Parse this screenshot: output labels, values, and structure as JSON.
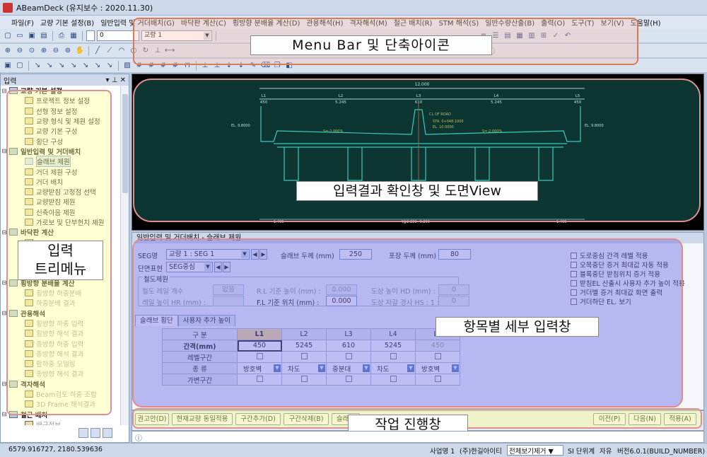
{
  "window": {
    "title": "ABeamDeck  (유지보수 : 2020.11.30)"
  },
  "menu": [
    "파일(F)",
    "교량 기본 설정(B)",
    "일반입력 및 거더배치(G)",
    "바닥판 계산(C)",
    "횡방향 분배율 계산(D)",
    "관용해석(H)",
    "격자해석(M)",
    "철근 배치(R)",
    "STM 해석(S)",
    "일반수량산출(B)",
    "출력(O)",
    "도구(T)",
    "보기(V)",
    "도움말(H)"
  ],
  "toolbar": {
    "combo1": "0",
    "combo2": "교량 1"
  },
  "callouts": {
    "menu": "Menu Bar 및 단축아이콘",
    "tree": "입력\n트리메뉴",
    "drawing": "입력결과 확인창 및 도면View",
    "detail": "항목별 세부 입력창",
    "action": "작업 진행창"
  },
  "left_panel": {
    "title": "입력",
    "tree": [
      {
        "group": "교량 기본 설정",
        "items": [
          {
            "label": "프로젝트 정보 설정"
          },
          {
            "label": "선형 정보 설정"
          },
          {
            "label": "교량 형식 및 제원 설정"
          },
          {
            "label": "교량 기본 구성"
          },
          {
            "label": "횡단 구성"
          }
        ]
      },
      {
        "group": "일반입력 및 거더배치",
        "items": [
          {
            "label": "슬래브 제원",
            "selected": true
          },
          {
            "label": "거더 제원 구성"
          },
          {
            "label": "거더 배치"
          },
          {
            "label": "교량받침 고정점 선택"
          },
          {
            "label": "교량받침 제원"
          },
          {
            "label": "신축이음 제원"
          },
          {
            "label": "가로보 및 단부헌치 제원"
          }
        ]
      },
      {
        "group": "바닥판 계산",
        "items": [
          {
            "label": "",
            "disabled": true
          },
          {
            "label": "",
            "disabled": true
          },
          {
            "label": "",
            "disabled": true
          },
          {
            "label": "",
            "disabled": true
          }
        ]
      },
      {
        "group": "횡방향 분배율 계산",
        "items": [
          {
            "label": "횡방향 하중분배",
            "disabled": true
          },
          {
            "label": "하중분배 결과",
            "disabled": true
          }
        ]
      },
      {
        "group": "관용해석",
        "items": [
          {
            "label": "횡방향 하중 입력",
            "disabled": true
          },
          {
            "label": "횡방향 해석 결과",
            "disabled": true
          },
          {
            "label": "종방향 하중 입력",
            "disabled": true
          },
          {
            "label": "종방향 해석 결과",
            "disabled": true
          },
          {
            "label": "활하중 모델링",
            "disabled": true
          },
          {
            "label": "종방향 해석 결과",
            "disabled": true
          }
        ]
      },
      {
        "group": "격자해석",
        "items": [
          {
            "label": "Beam검토 하중 조합",
            "disabled": true
          },
          {
            "label": "3D Frame 해석결과",
            "disabled": true
          }
        ]
      },
      {
        "group": "철근 배치",
        "items": [
          {
            "label": "배근정보",
            "disabled": true
          }
        ]
      }
    ]
  },
  "drawing": {
    "dims_top": [
      "12.000"
    ],
    "dims_spans": [
      "L1",
      "L2",
      "L3",
      "L4",
      "L5"
    ],
    "dims_values": [
      "450",
      "5.245",
      "610",
      "5.245",
      "450"
    ],
    "el_left": "EL. 9.8000",
    "el_right": "EL. 9.8000",
    "slope_left": "S=-2.000%",
    "slope_right": "S=-2.000%",
    "center_labels": [
      "CL OF ROAD",
      "STA. 0+048.1000",
      "EL. 10.0000"
    ],
    "bottom_left": "1.400",
    "bottom_center": "4@2.300=9.200",
    "bottom_right": "1.400"
  },
  "detail": {
    "title": "일반입력 및 거더배치 - 슬래브 제원",
    "seg_label": "SEG명",
    "seg_value": "교량 1 : SEG 1",
    "section_label": "단면표현",
    "section_value": "SEG중심",
    "slab_thick_label": "슬래브 두께 (mm)",
    "slab_thick_value": "250",
    "pave_thick_label": "포장 두께 (mm)",
    "pave_thick_value": "80",
    "rail_group": "철도제원",
    "rail_count_label": "철도 레일 개수",
    "rail_count_value": "없음",
    "rail_height_label": "레일 높이 HR (mm) :",
    "rl_label": "R.L 기준 높이 (mm) :",
    "rl_value": "0.000",
    "fl_label": "F.L 기준 위치 (mm) :",
    "fl_value": "0.000",
    "hd_label": "도상 높이 HD (mm) :",
    "hd_value": "0",
    "hs_label": "도상 자갈 경사 HS : 1 :",
    "hs_value": "0",
    "options": [
      "도로중심 간격 레벨 적용",
      "오목중단 증거 최대값 자동 적용",
      "블록중단 받침위치 증거 적용",
      "받침EL 산출시 사용자 추가 높이 적용",
      "거더별 증거 최대값 화면 출력",
      "거더하단 EL. 보기"
    ],
    "tabs": [
      "슬래브 횡단",
      "사용자 추가 높이"
    ],
    "grid": {
      "corner": "구 분",
      "columns": [
        "L1",
        "L2",
        "L3",
        "L4",
        "L5"
      ],
      "rows": [
        {
          "label": "간격(mm)",
          "values": [
            "450",
            "5245",
            "610",
            "5245",
            "450"
          ]
        },
        {
          "label": "레벨구간",
          "values": [
            "",
            "",
            "",
            "",
            ""
          ]
        },
        {
          "label": "종 류",
          "values": [
            "방호벽",
            "차도",
            "중분대",
            "차도",
            "방호벽"
          ]
        },
        {
          "label": "가변구간",
          "values": [
            "",
            "",
            "",
            "",
            ""
          ]
        }
      ]
    }
  },
  "actions": {
    "buttons": [
      "권고안(D)",
      "현재교량 동일적용",
      "구간추가(D)",
      "구간삭제(B)",
      "슬래브"
    ],
    "prev": "이전(P)",
    "next": "다음(N)",
    "apply": "적용(A)"
  },
  "status": {
    "coords": "6579.916727,    2180.539636",
    "project_label": "사업명 1",
    "company": "(주)한길아이티",
    "view_mode": "전체보기제거",
    "units": "SI 단위계",
    "free": "자유",
    "version": "버전6.0.1(BUILD_NUMBER)"
  }
}
